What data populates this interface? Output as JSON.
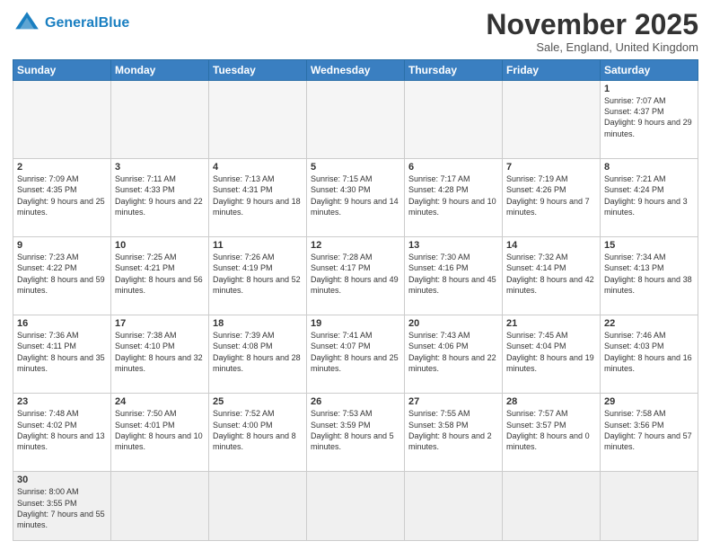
{
  "logo": {
    "line1": "General",
    "line2": "Blue"
  },
  "header": {
    "title": "November 2025",
    "subtitle": "Sale, England, United Kingdom"
  },
  "weekdays": [
    "Sunday",
    "Monday",
    "Tuesday",
    "Wednesday",
    "Thursday",
    "Friday",
    "Saturday"
  ],
  "days": {
    "d1": {
      "num": "1",
      "sunrise": "7:07 AM",
      "sunset": "4:37 PM",
      "daylight": "9 hours and 29 minutes."
    },
    "d2": {
      "num": "2",
      "sunrise": "7:09 AM",
      "sunset": "4:35 PM",
      "daylight": "9 hours and 25 minutes."
    },
    "d3": {
      "num": "3",
      "sunrise": "7:11 AM",
      "sunset": "4:33 PM",
      "daylight": "9 hours and 22 minutes."
    },
    "d4": {
      "num": "4",
      "sunrise": "7:13 AM",
      "sunset": "4:31 PM",
      "daylight": "9 hours and 18 minutes."
    },
    "d5": {
      "num": "5",
      "sunrise": "7:15 AM",
      "sunset": "4:30 PM",
      "daylight": "9 hours and 14 minutes."
    },
    "d6": {
      "num": "6",
      "sunrise": "7:17 AM",
      "sunset": "4:28 PM",
      "daylight": "9 hours and 10 minutes."
    },
    "d7": {
      "num": "7",
      "sunrise": "7:19 AM",
      "sunset": "4:26 PM",
      "daylight": "9 hours and 7 minutes."
    },
    "d8": {
      "num": "8",
      "sunrise": "7:21 AM",
      "sunset": "4:24 PM",
      "daylight": "9 hours and 3 minutes."
    },
    "d9": {
      "num": "9",
      "sunrise": "7:23 AM",
      "sunset": "4:22 PM",
      "daylight": "8 hours and 59 minutes."
    },
    "d10": {
      "num": "10",
      "sunrise": "7:25 AM",
      "sunset": "4:21 PM",
      "daylight": "8 hours and 56 minutes."
    },
    "d11": {
      "num": "11",
      "sunrise": "7:26 AM",
      "sunset": "4:19 PM",
      "daylight": "8 hours and 52 minutes."
    },
    "d12": {
      "num": "12",
      "sunrise": "7:28 AM",
      "sunset": "4:17 PM",
      "daylight": "8 hours and 49 minutes."
    },
    "d13": {
      "num": "13",
      "sunrise": "7:30 AM",
      "sunset": "4:16 PM",
      "daylight": "8 hours and 45 minutes."
    },
    "d14": {
      "num": "14",
      "sunrise": "7:32 AM",
      "sunset": "4:14 PM",
      "daylight": "8 hours and 42 minutes."
    },
    "d15": {
      "num": "15",
      "sunrise": "7:34 AM",
      "sunset": "4:13 PM",
      "daylight": "8 hours and 38 minutes."
    },
    "d16": {
      "num": "16",
      "sunrise": "7:36 AM",
      "sunset": "4:11 PM",
      "daylight": "8 hours and 35 minutes."
    },
    "d17": {
      "num": "17",
      "sunrise": "7:38 AM",
      "sunset": "4:10 PM",
      "daylight": "8 hours and 32 minutes."
    },
    "d18": {
      "num": "18",
      "sunrise": "7:39 AM",
      "sunset": "4:08 PM",
      "daylight": "8 hours and 28 minutes."
    },
    "d19": {
      "num": "19",
      "sunrise": "7:41 AM",
      "sunset": "4:07 PM",
      "daylight": "8 hours and 25 minutes."
    },
    "d20": {
      "num": "20",
      "sunrise": "7:43 AM",
      "sunset": "4:06 PM",
      "daylight": "8 hours and 22 minutes."
    },
    "d21": {
      "num": "21",
      "sunrise": "7:45 AM",
      "sunset": "4:04 PM",
      "daylight": "8 hours and 19 minutes."
    },
    "d22": {
      "num": "22",
      "sunrise": "7:46 AM",
      "sunset": "4:03 PM",
      "daylight": "8 hours and 16 minutes."
    },
    "d23": {
      "num": "23",
      "sunrise": "7:48 AM",
      "sunset": "4:02 PM",
      "daylight": "8 hours and 13 minutes."
    },
    "d24": {
      "num": "24",
      "sunrise": "7:50 AM",
      "sunset": "4:01 PM",
      "daylight": "8 hours and 10 minutes."
    },
    "d25": {
      "num": "25",
      "sunrise": "7:52 AM",
      "sunset": "4:00 PM",
      "daylight": "8 hours and 8 minutes."
    },
    "d26": {
      "num": "26",
      "sunrise": "7:53 AM",
      "sunset": "3:59 PM",
      "daylight": "8 hours and 5 minutes."
    },
    "d27": {
      "num": "27",
      "sunrise": "7:55 AM",
      "sunset": "3:58 PM",
      "daylight": "8 hours and 2 minutes."
    },
    "d28": {
      "num": "28",
      "sunrise": "7:57 AM",
      "sunset": "3:57 PM",
      "daylight": "8 hours and 0 minutes."
    },
    "d29": {
      "num": "29",
      "sunrise": "7:58 AM",
      "sunset": "3:56 PM",
      "daylight": "7 hours and 57 minutes."
    },
    "d30": {
      "num": "30",
      "sunrise": "8:00 AM",
      "sunset": "3:55 PM",
      "daylight": "7 hours and 55 minutes."
    }
  }
}
